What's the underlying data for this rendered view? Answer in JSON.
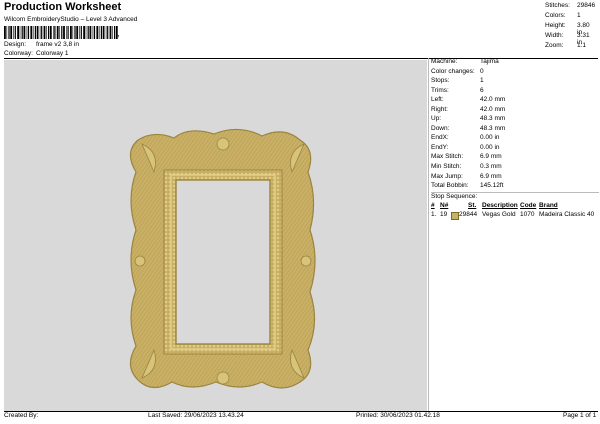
{
  "header": {
    "title": "Production Worksheet",
    "subtitle": "Wilcom EmbroideryStudio – Level 3 Advanced",
    "design_label": "Design:",
    "design_value": "frame v2 3,8 in",
    "colorway_label": "Colorway:",
    "colorway_value": "Colorway 1",
    "barcode_suffix": ","
  },
  "top_stats": [
    {
      "label": "Stitches:",
      "value": "29846"
    },
    {
      "label": "Colors:",
      "value": "1"
    },
    {
      "label": "Height:",
      "value": "3.80 in"
    },
    {
      "label": "Width:",
      "value": "3.31 in"
    },
    {
      "label": "Zoom:",
      "value": "1:1"
    }
  ],
  "machine_info": [
    {
      "label": "Machine:",
      "value": "Tajima"
    },
    {
      "label": "Color changes:",
      "value": "0"
    },
    {
      "label": "Stops:",
      "value": "1"
    },
    {
      "label": "Trims:",
      "value": "6"
    },
    {
      "label": "Left:",
      "value": "42.0 mm"
    },
    {
      "label": "Right:",
      "value": "42.0 mm"
    },
    {
      "label": "Up:",
      "value": "48.3 mm"
    },
    {
      "label": "Down:",
      "value": "48.3 mm"
    },
    {
      "label": "EndX:",
      "value": "0.00 in"
    },
    {
      "label": "EndY:",
      "value": "0.00 in"
    },
    {
      "label": "Max Stitch:",
      "value": "6.9 mm"
    },
    {
      "label": "Min Stitch:",
      "value": "0.3 mm"
    },
    {
      "label": "Max Jump:",
      "value": "6.9 mm"
    },
    {
      "label": "Total Bobbin:",
      "value": "145.12ft"
    }
  ],
  "stop_sequence": {
    "title": "Stop Sequence:",
    "headers": {
      "num": "#",
      "n": "N#",
      "st": "St.",
      "desc": "Description",
      "code": "Code",
      "brand": "Brand"
    },
    "rows": [
      {
        "num": "1.",
        "n": "19",
        "st": "29844",
        "desc": "Vegas Gold",
        "code": "1070",
        "brand": "Madeira Classic 40",
        "color": "#c9b064"
      }
    ]
  },
  "footer": {
    "created_by": "Created By:",
    "last_saved": "Last Saved: 29/06/2023 13.43.24",
    "printed": "Printed: 30/06/2023 01.42.18",
    "page": "Page 1 of 1"
  },
  "colors": {
    "canvas_bg": "#d9d9d9",
    "thread": "#c9b064",
    "thread_dark": "#9a8440",
    "thread_light": "#e2cf8a"
  }
}
